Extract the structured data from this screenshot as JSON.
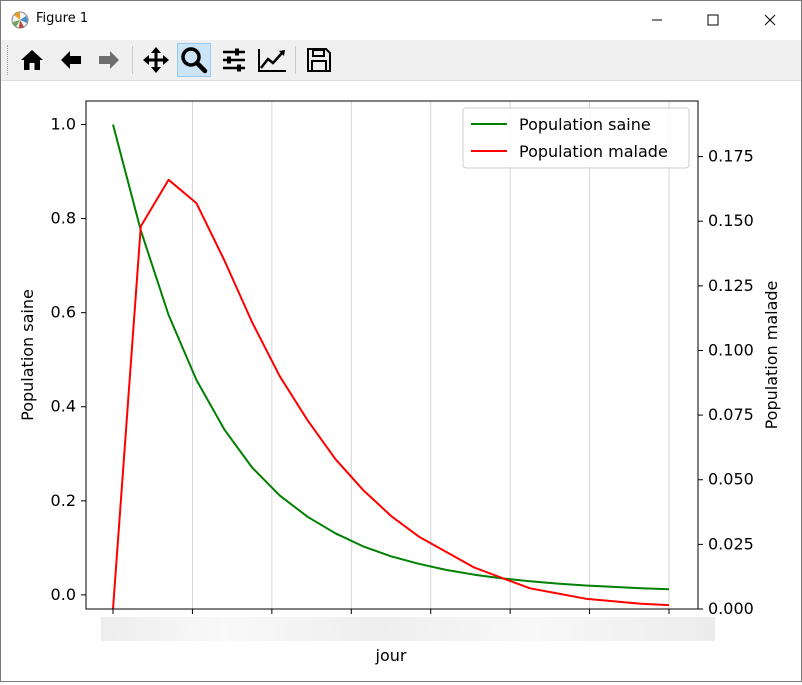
{
  "window": {
    "title": "Figure 1"
  },
  "toolbar": {
    "buttons": [
      {
        "name": "home-icon",
        "tooltip": "Home"
      },
      {
        "name": "back-icon",
        "tooltip": "Back"
      },
      {
        "name": "forward-icon",
        "tooltip": "Forward"
      },
      {
        "name": "pan-icon",
        "tooltip": "Pan"
      },
      {
        "name": "zoom-icon",
        "tooltip": "Zoom",
        "active": true
      },
      {
        "name": "configure-subplots-icon",
        "tooltip": "Subplots"
      },
      {
        "name": "edit-axes-icon",
        "tooltip": "Customize"
      },
      {
        "name": "save-icon",
        "tooltip": "Save"
      }
    ]
  },
  "colors": {
    "saine": "#008000",
    "malade": "#ff0000",
    "active_button": "#cce4f7"
  },
  "chart_data": {
    "type": "line",
    "xlabel": "jour",
    "ylabel_left": "Population saine",
    "ylabel_right": "Population malade",
    "x_ticklabels_visible": false,
    "grid": "vertical",
    "legend_position": "top-right",
    "legend": [
      "Population saine",
      "Population malade"
    ],
    "x": [
      0,
      1,
      2,
      3,
      4,
      5,
      6,
      7,
      8,
      9,
      10,
      11,
      12,
      13,
      14,
      15,
      16,
      17,
      18,
      19,
      20
    ],
    "left_axis": {
      "ylim": [
        -0.03,
        1.05
      ],
      "ticks": [
        "0.0",
        "0.2",
        "0.4",
        "0.6",
        "0.8",
        "1.0"
      ]
    },
    "right_axis": {
      "ylim": [
        0.0,
        0.1965
      ],
      "ticks": [
        "0.000",
        "0.025",
        "0.050",
        "0.075",
        "0.100",
        "0.125",
        "0.150",
        "0.175"
      ]
    },
    "series": [
      {
        "name": "Population saine",
        "axis": "left",
        "values": [
          1.0,
          0.775,
          0.595,
          0.457,
          0.352,
          0.271,
          0.211,
          0.166,
          0.131,
          0.103,
          0.082,
          0.066,
          0.053,
          0.043,
          0.035,
          0.029,
          0.024,
          0.02,
          0.017,
          0.014,
          0.012
        ]
      },
      {
        "name": "Population malade",
        "axis": "right",
        "values": [
          0.0,
          0.148,
          0.166,
          0.157,
          0.135,
          0.111,
          0.09,
          0.073,
          0.058,
          0.046,
          0.036,
          0.028,
          0.022,
          0.016,
          0.012,
          0.008,
          0.006,
          0.004,
          0.003,
          0.002,
          0.0015
        ]
      }
    ]
  }
}
